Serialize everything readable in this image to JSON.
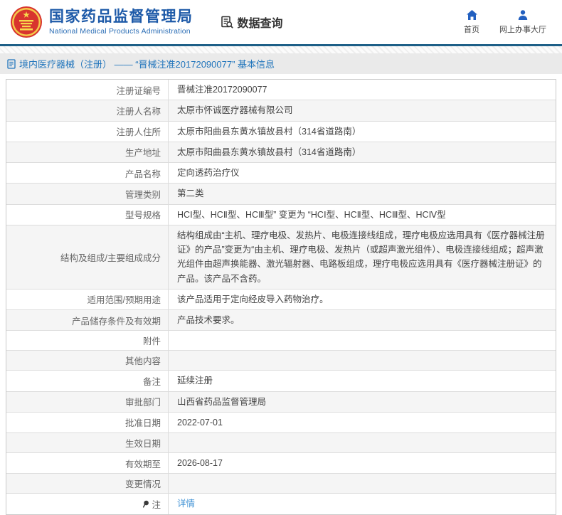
{
  "header": {
    "org_name_zh": "国家药品监督管理局",
    "org_name_en": "National Medical Products Administration",
    "data_query_label": "数据查询",
    "nav": [
      {
        "label": "首页",
        "icon": "home-icon"
      },
      {
        "label": "网上办事大厅",
        "icon": "person-icon"
      }
    ]
  },
  "breadcrumb": {
    "text": "境内医疗器械（注册） —— “晋械注准20172090077” 基本信息"
  },
  "table": {
    "rows": [
      {
        "label": "注册证编号",
        "value": "晋械注准20172090077"
      },
      {
        "label": "注册人名称",
        "value": "太原市怀诚医疗器械有限公司"
      },
      {
        "label": "注册人住所",
        "value": "太原市阳曲县东黄水镇故县村（314省道路南）"
      },
      {
        "label": "生产地址",
        "value": "太原市阳曲县东黄水镇故县村（314省道路南）"
      },
      {
        "label": "产品名称",
        "value": "定向透药治疗仪"
      },
      {
        "label": "管理类别",
        "value": "第二类"
      },
      {
        "label": "型号规格",
        "value": "HCⅠ型、HCⅡ型、HCⅢ型” 变更为 “HCⅠ型、HCⅡ型、HCⅢ型、HCⅣ型"
      },
      {
        "label": "结构及组成/主要组成成分",
        "value": "结构组成由“主机、理疗电极、发热片、电极连接线组成，理疗电极应选用具有《医疗器械注册证》的产品”变更为“由主机、理疗电极、发热片（或超声激光组件）、电极连接线组成；超声激光组件由超声换能器、激光辐射器、电路板组成，理疗电极应选用具有《医疗器械注册证》的产品。该产品不含药。"
      },
      {
        "label": "适用范围/预期用途",
        "value": "该产品适用于定向经皮导入药物治疗。"
      },
      {
        "label": "产品储存条件及有效期",
        "value": "产品技术要求。"
      },
      {
        "label": "附件",
        "value": ""
      },
      {
        "label": "其他内容",
        "value": ""
      },
      {
        "label": "备注",
        "value": "延续注册"
      },
      {
        "label": "审批部门",
        "value": "山西省药品监督管理局"
      },
      {
        "label": "批准日期",
        "value": "2022-07-01"
      },
      {
        "label": "生效日期",
        "value": ""
      },
      {
        "label": "有效期至",
        "value": "2026-08-17"
      },
      {
        "label": "变更情况",
        "value": ""
      },
      {
        "label": "注",
        "label_icon": "note-icon",
        "value": "详情",
        "link": true
      }
    ]
  },
  "colors": {
    "brand_blue": "#1e5aa8",
    "icon_blue": "#2360c0",
    "breadcrumb_blue": "#2175bc",
    "link_blue": "#4193d5",
    "divider_teal": "#1d5f87",
    "breadcrumb_bar_bg": "#eaeaea",
    "alt_row_bg": "#f5f5f5",
    "emblem_red": "#d8342e",
    "emblem_gold": "#f7d94c"
  }
}
